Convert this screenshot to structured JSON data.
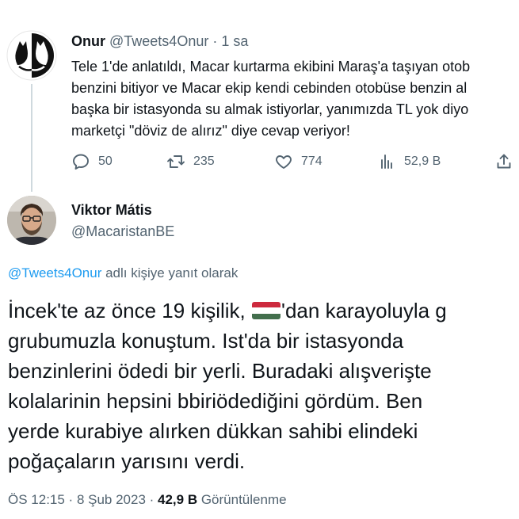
{
  "parent_tweet": {
    "author_name": "Onur",
    "author_handle": "@Tweets4Onur",
    "separator": "·",
    "time": "1 sa",
    "text_lines": [
      "Tele 1'de anlatıldı, Macar kurtarma ekibini Maraş'a taşıyan otob",
      "benzini bitiyor ve Macar ekip kendi cebinden otobüse benzin al",
      "başka bir istasyonda su almak istiyorlar, yanımızda TL yok diyo",
      "marketçi \"döviz de alırız\" diye cevap veriyor!"
    ],
    "actions": {
      "replies": "50",
      "retweets": "235",
      "likes": "774",
      "views": "52,9 B"
    }
  },
  "reply_tweet": {
    "author_name": "Viktor Mátis",
    "author_handle": "@MacaristanBE",
    "reply_context": {
      "mention": "@Tweets4Onur",
      "suffix": " adlı kişiye yanıt olarak"
    },
    "text_line_1_before_flag": "İncek'te az önce 19 kişilik, ",
    "text_line_1_after_flag": "'dan karayoluyla g",
    "text_lines_rest": [
      "grubumuzla konuştum. Ist'da bir istasyonda",
      "benzinlerini ödedi bir yerli. Buradaki alışverişte",
      "kolalarinin hepsini bbiriödediğini gördüm. Ben",
      "yerde kurabiye alırken dükkan sahibi elindeki",
      "poğaçaların yarısını verdi."
    ],
    "meta": {
      "time": "ÖS 12:15",
      "separator": " · ",
      "date": "8 Şub 2023",
      "separator2": " · ",
      "views_count": "42,9 B",
      "views_label": " Görüntülenme"
    }
  },
  "colors": {
    "text_primary": "#0f1419",
    "text_secondary": "#536471",
    "link": "#1d9bf0",
    "thread_line": "#cfd9de",
    "flag_red": "#cd2a3e",
    "flag_white": "#ffffff",
    "flag_green": "#436f4d"
  },
  "icons": {
    "reply": "reply-bubble-icon",
    "retweet": "retweet-icon",
    "like": "heart-icon",
    "views": "bar-chart-icon",
    "share": "share-icon",
    "flag": "hungary-flag-emoji"
  }
}
